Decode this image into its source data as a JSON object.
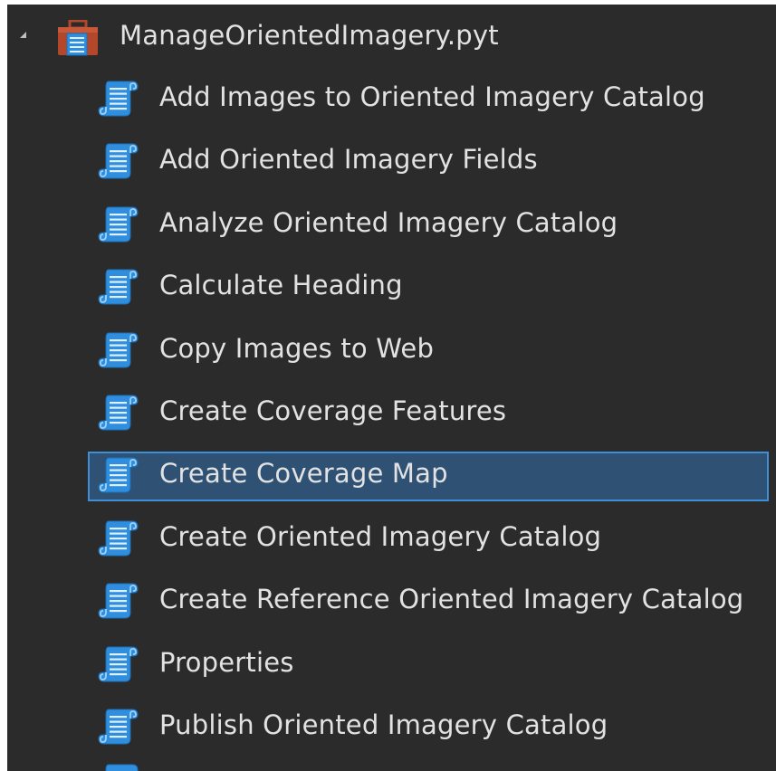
{
  "root": {
    "label": "ManageOrientedImagery.pyt",
    "icon": "toolbox-icon",
    "expanded": true
  },
  "tools": [
    {
      "label": "Add Images to Oriented Imagery Catalog",
      "icon": "python-script-icon",
      "selected": false
    },
    {
      "label": "Add Oriented Imagery Fields",
      "icon": "python-script-icon",
      "selected": false
    },
    {
      "label": "Analyze Oriented Imagery Catalog",
      "icon": "python-script-icon",
      "selected": false
    },
    {
      "label": "Calculate Heading",
      "icon": "python-script-icon",
      "selected": false
    },
    {
      "label": "Copy Images to Web",
      "icon": "python-script-icon",
      "selected": false
    },
    {
      "label": "Create Coverage Features",
      "icon": "python-script-icon",
      "selected": false
    },
    {
      "label": "Create Coverage Map",
      "icon": "python-script-icon",
      "selected": true
    },
    {
      "label": "Create Oriented Imagery Catalog",
      "icon": "python-script-icon",
      "selected": false
    },
    {
      "label": "Create Reference Oriented Imagery Catalog",
      "icon": "python-script-icon",
      "selected": false
    },
    {
      "label": "Properties",
      "icon": "python-script-icon",
      "selected": false
    },
    {
      "label": "Publish Oriented Imagery Catalog",
      "icon": "python-script-icon",
      "selected": false
    }
  ],
  "colors": {
    "panel_background": "#2b2b2b",
    "text": "#e2e2e2",
    "selection_fill": "#2e5174",
    "selection_border": "#3e8fd8",
    "icon_blue": "#2f8fde",
    "toolbox_red": "#b4462a"
  }
}
